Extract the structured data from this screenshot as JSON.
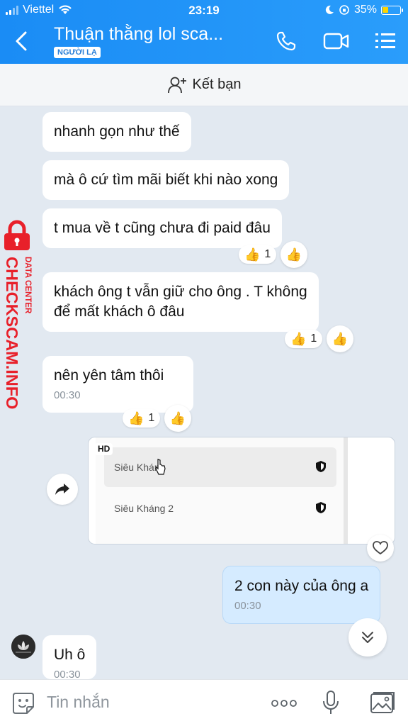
{
  "status_bar": {
    "carrier": "Viettel",
    "time": "23:19",
    "battery": "35%"
  },
  "header": {
    "title": "Thuận thằng lol sca...",
    "badge": "NGƯỜI LẠ"
  },
  "friend_bar": {
    "label": "Kết bạn"
  },
  "messages": [
    {
      "text": "nhanh gọn như thế"
    },
    {
      "text": "mà ô cứ tìm mãi biết khi nào xong"
    },
    {
      "text": "t mua về t cũng chưa đi paid đâu",
      "reaction_count": "1"
    },
    {
      "line1": "khách ông t vẫn giữ cho ông . T không",
      "line2": "để mất khách ô đâu",
      "reaction_count": "1"
    },
    {
      "text": "nên yên tâm thôi",
      "time": "00:30",
      "reaction_count": "1"
    }
  ],
  "shared_card": {
    "badge": "HD",
    "rows": [
      {
        "label": "Siêu Kháng"
      },
      {
        "label": "Siêu Kháng 2"
      }
    ]
  },
  "my_message": {
    "text": "2 con này của ông a",
    "time": "00:30"
  },
  "last_message": {
    "text": "Uh ô",
    "time": "00:30"
  },
  "input": {
    "placeholder": "Tin nhắn"
  },
  "watermark": {
    "main": "CHECKSCAM.INFO",
    "sub": "DATA CENTER"
  },
  "colors": {
    "header": "#1a8cf5",
    "my_bubble": "#d5ebff",
    "watermark": "#e8202a"
  }
}
